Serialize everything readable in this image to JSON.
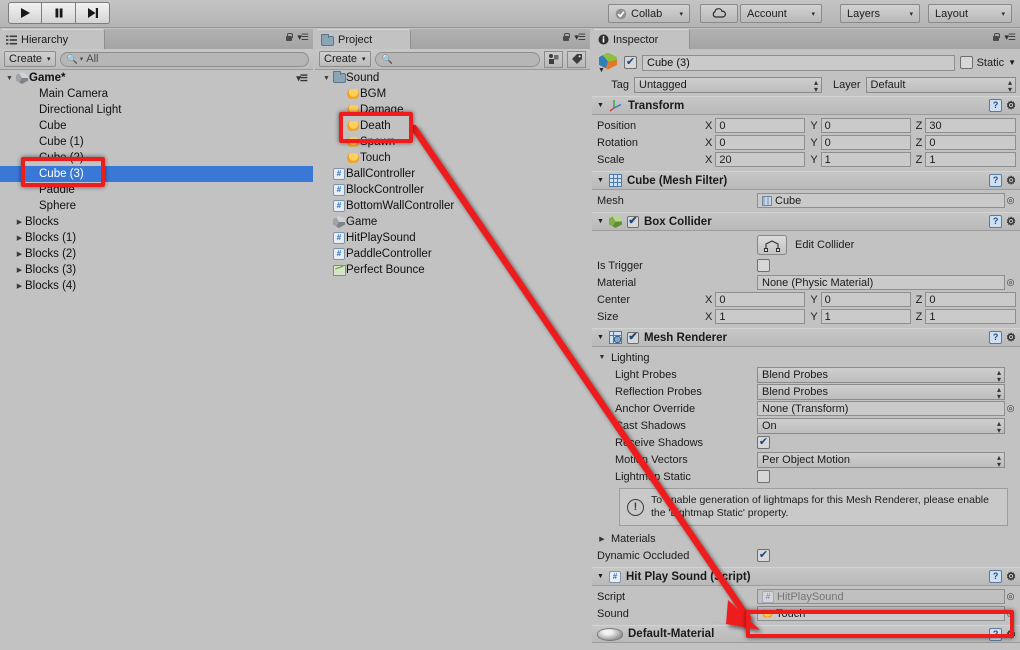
{
  "toolbar": {
    "play_label": "play-icon",
    "pause_label": "pause-icon",
    "step_label": "step-icon",
    "collab": "Collab",
    "cloud": "cloud-icon",
    "account": "Account",
    "layers": "Layers",
    "layout": "Layout",
    "caret": "▾"
  },
  "hierarchy": {
    "tab_title": "Hierarchy",
    "create_label": "Create",
    "search_value": "All",
    "scene_name": "Game*",
    "items": [
      {
        "label": "Main Camera",
        "indent": 1,
        "arrow": "",
        "icon": "",
        "selected": false
      },
      {
        "label": "Directional Light",
        "indent": 1,
        "arrow": "",
        "icon": "",
        "selected": false
      },
      {
        "label": "Cube",
        "indent": 1,
        "arrow": "",
        "icon": "",
        "selected": false
      },
      {
        "label": "Cube (1)",
        "indent": 1,
        "arrow": "",
        "icon": "",
        "selected": false
      },
      {
        "label": "Cube (2)",
        "indent": 1,
        "arrow": "",
        "icon": "",
        "selected": false
      },
      {
        "label": "Cube (3)",
        "indent": 1,
        "arrow": "",
        "icon": "",
        "selected": true
      },
      {
        "label": "Paddle",
        "indent": 1,
        "arrow": "",
        "icon": "",
        "selected": false
      },
      {
        "label": "Sphere",
        "indent": 1,
        "arrow": "",
        "icon": "",
        "selected": false
      },
      {
        "label": "Blocks",
        "indent": 0,
        "arrow": "▶",
        "icon": "",
        "selected": false
      },
      {
        "label": "Blocks (1)",
        "indent": 0,
        "arrow": "▶",
        "icon": "",
        "selected": false
      },
      {
        "label": "Blocks (2)",
        "indent": 0,
        "arrow": "▶",
        "icon": "",
        "selected": false
      },
      {
        "label": "Blocks (3)",
        "indent": 0,
        "arrow": "▶",
        "icon": "",
        "selected": false
      },
      {
        "label": "Blocks (4)",
        "indent": 0,
        "arrow": "▶",
        "icon": "",
        "selected": false
      }
    ]
  },
  "project": {
    "tab_title": "Project",
    "create_label": "Create",
    "search_value": "",
    "items": [
      {
        "label": "Sound",
        "indent": 0,
        "arrow": "▼",
        "icon": "folder"
      },
      {
        "label": "BGM",
        "indent": 1,
        "arrow": "",
        "icon": "audio"
      },
      {
        "label": "Damage",
        "indent": 1,
        "arrow": "",
        "icon": "audio"
      },
      {
        "label": "Death",
        "indent": 1,
        "arrow": "",
        "icon": "audio"
      },
      {
        "label": "Spawn",
        "indent": 1,
        "arrow": "",
        "icon": "audio"
      },
      {
        "label": "Touch",
        "indent": 1,
        "arrow": "",
        "icon": "audio"
      },
      {
        "label": "BallController",
        "indent": 0,
        "arrow": "",
        "icon": "cs"
      },
      {
        "label": "BlockController",
        "indent": 0,
        "arrow": "",
        "icon": "cs"
      },
      {
        "label": "BottomWallController",
        "indent": 0,
        "arrow": "",
        "icon": "cs"
      },
      {
        "label": "Game",
        "indent": 0,
        "arrow": "",
        "icon": "unity"
      },
      {
        "label": "HitPlaySound",
        "indent": 0,
        "arrow": "",
        "icon": "cs"
      },
      {
        "label": "PaddleController",
        "indent": 0,
        "arrow": "",
        "icon": "cs"
      },
      {
        "label": "Perfect Bounce",
        "indent": 0,
        "arrow": "",
        "icon": "anim"
      }
    ]
  },
  "inspector": {
    "tab_title": "Inspector",
    "object_name": "Cube (3)",
    "enabled": true,
    "static_label": "Static",
    "static_checked": false,
    "tag_label": "Tag",
    "tag_value": "Untagged",
    "layer_label": "Layer",
    "layer_value": "Default",
    "transform": {
      "title": "Transform",
      "position": {
        "label": "Position",
        "x": "0",
        "y": "0",
        "z": "30"
      },
      "rotation": {
        "label": "Rotation",
        "x": "0",
        "y": "0",
        "z": "0"
      },
      "scale": {
        "label": "Scale",
        "x": "20",
        "y": "1",
        "z": "1"
      }
    },
    "mesh_filter": {
      "title": "Cube (Mesh Filter)",
      "mesh_label": "Mesh",
      "mesh_value": "Cube"
    },
    "box_collider": {
      "title": "Box Collider",
      "enabled": true,
      "edit_collider_label": "Edit Collider",
      "is_trigger_label": "Is Trigger",
      "is_trigger_checked": false,
      "material_label": "Material",
      "material_value": "None (Physic Material)",
      "center": {
        "label": "Center",
        "x": "0",
        "y": "0",
        "z": "0"
      },
      "size": {
        "label": "Size",
        "x": "1",
        "y": "1",
        "z": "1"
      }
    },
    "mesh_renderer": {
      "title": "Mesh Renderer",
      "enabled": true,
      "lighting_label": "Lighting",
      "light_probes_label": "Light Probes",
      "light_probes_value": "Blend Probes",
      "reflection_probes_label": "Reflection Probes",
      "reflection_probes_value": "Blend Probes",
      "anchor_override_label": "Anchor Override",
      "anchor_override_value": "None (Transform)",
      "cast_shadows_label": "Cast Shadows",
      "cast_shadows_value": "On",
      "receive_shadows_label": "Receive Shadows",
      "receive_shadows_checked": true,
      "motion_vectors_label": "Motion Vectors",
      "motion_vectors_value": "Per Object Motion",
      "lightmap_static_label": "Lightmap Static",
      "lightmap_static_checked": false,
      "help_text": "To enable generation of lightmaps for this Mesh Renderer, please enable the 'Lightmap Static' property.",
      "materials_label": "Materials",
      "dynamic_occluded_label": "Dynamic Occluded",
      "dynamic_occluded_checked": true
    },
    "hit_play_sound": {
      "title": "Hit Play Sound (Script)",
      "script_label": "Script",
      "script_value": "HitPlaySound",
      "sound_label": "Sound",
      "sound_value": "Touch"
    },
    "default_material": {
      "title": "Default-Material"
    }
  },
  "annotations": {
    "accent_color": "#ee1c1c",
    "highlights": [
      {
        "name": "hierarchy-cube3-highlight"
      },
      {
        "name": "project-death-highlight"
      },
      {
        "name": "inspector-sound-touch-highlight"
      }
    ],
    "arrow": {
      "from": "Death",
      "to": "Sound field (Touch)"
    }
  }
}
